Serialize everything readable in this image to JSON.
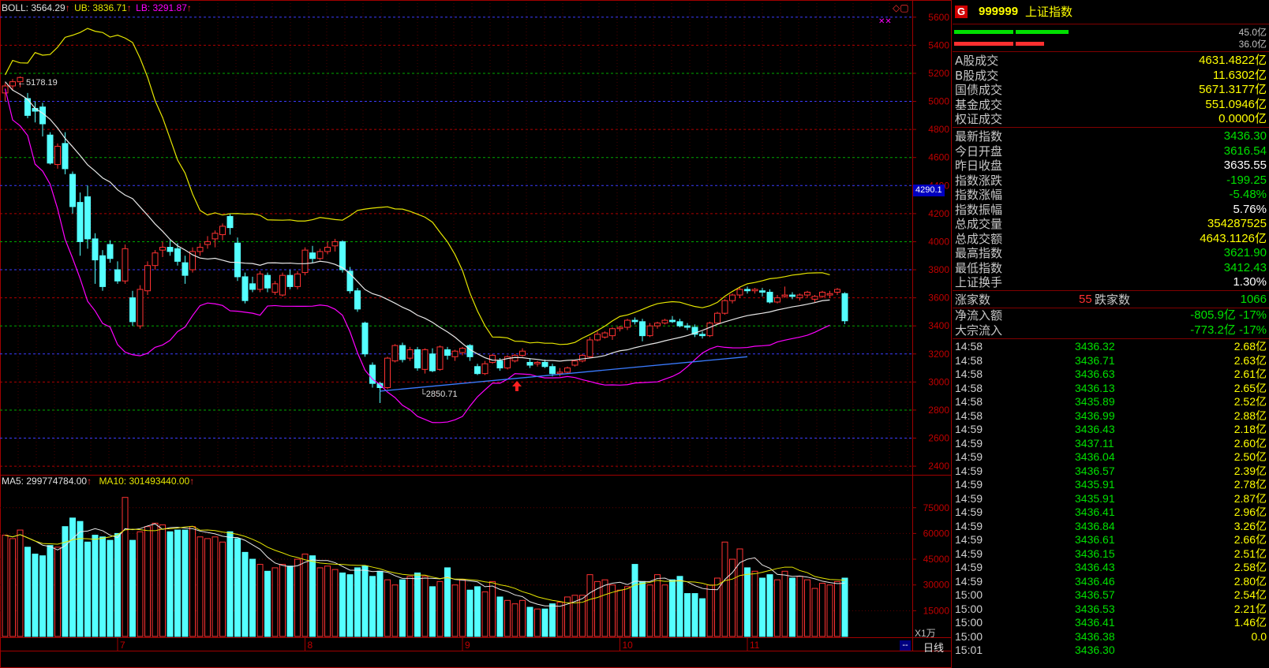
{
  "colors": {
    "up": "#ff3232",
    "down": "#54ffff",
    "mid": "#e8e8e8",
    "upper": "#e6e600",
    "lower": "#ff00ff",
    "grid_red": "#b00000",
    "grid_blue": "#3c3cff",
    "grid_green": "#00aa00",
    "axis_text": "#c00000",
    "panel_green": "#00e000",
    "panel_yellow": "#ffff00",
    "panel_red": "#ff3030"
  },
  "indicators": {
    "boll_label": "BOLL: 3564.29",
    "ub_label": "UB: 3836.71",
    "lb_label": "LB: 3291.87",
    "ma5_label": "MA5: 299774784.00",
    "ma10_label": "MA10: 301493440.00"
  },
  "price_axis": {
    "ticks": [
      "5600",
      "5400",
      "5200",
      "5000",
      "4800",
      "4600",
      "4400",
      "4200",
      "4000",
      "3800",
      "3600",
      "3400",
      "3200",
      "3000",
      "2800",
      "2600",
      "2400"
    ],
    "cursor_value": "4290.1"
  },
  "volume_axis": {
    "ticks": [
      "75000",
      "60000",
      "45000",
      "30000",
      "15000"
    ],
    "unit": "X1万"
  },
  "x_axis": {
    "month_labels": [
      "7",
      "8",
      "9",
      "10",
      "11"
    ],
    "period": "日线"
  },
  "annotations": {
    "high": "5178.19",
    "low": "2850.71"
  },
  "chart_data": {
    "type": "candlestick",
    "ohlc": [
      [
        5060,
        5130,
        5000,
        5110
      ],
      [
        5110,
        5160,
        5080,
        5140
      ],
      [
        5140,
        5178,
        5100,
        5170
      ],
      [
        5020,
        5060,
        4880,
        4900
      ],
      [
        4950,
        5000,
        4850,
        4930
      ],
      [
        4960,
        4990,
        4750,
        4840
      ],
      [
        4760,
        4780,
        4550,
        4560
      ],
      [
        4550,
        4700,
        4520,
        4680
      ],
      [
        4700,
        4780,
        4480,
        4520
      ],
      [
        4480,
        4500,
        4200,
        4250
      ],
      [
        4280,
        4350,
        3900,
        4000
      ],
      [
        4320,
        4400,
        3950,
        4020
      ],
      [
        4020,
        4060,
        3700,
        3870
      ],
      [
        3900,
        3940,
        3650,
        3680
      ],
      [
        3980,
        4010,
        3850,
        3880
      ],
      [
        3800,
        3860,
        3700,
        3720
      ],
      [
        3720,
        3980,
        3700,
        3950
      ],
      [
        3600,
        3650,
        3400,
        3430
      ],
      [
        3400,
        3690,
        3380,
        3660
      ],
      [
        3650,
        3860,
        3620,
        3830
      ],
      [
        3830,
        3940,
        3800,
        3920
      ],
      [
        3940,
        4000,
        3890,
        3960
      ],
      [
        3960,
        4010,
        3900,
        3930
      ],
      [
        3950,
        3990,
        3830,
        3860
      ],
      [
        3850,
        3900,
        3700,
        3760
      ],
      [
        3800,
        3960,
        3780,
        3930
      ],
      [
        3930,
        3990,
        3900,
        3960
      ],
      [
        3980,
        4040,
        3950,
        4000
      ],
      [
        4020,
        4080,
        3960,
        4060
      ],
      [
        4050,
        4130,
        4010,
        4110
      ],
      [
        4180,
        4200,
        4050,
        4100
      ],
      [
        3990,
        4030,
        3720,
        3750
      ],
      [
        3750,
        3780,
        3560,
        3580
      ],
      [
        3700,
        3750,
        3640,
        3660
      ],
      [
        3660,
        3790,
        3640,
        3770
      ],
      [
        3760,
        3780,
        3640,
        3670
      ],
      [
        3640,
        3720,
        3620,
        3700
      ],
      [
        3620,
        3780,
        3610,
        3760
      ],
      [
        3760,
        3800,
        3660,
        3680
      ],
      [
        3680,
        3790,
        3660,
        3770
      ],
      [
        3780,
        3960,
        3760,
        3940
      ],
      [
        3920,
        3970,
        3850,
        3880
      ],
      [
        3880,
        3950,
        3870,
        3930
      ],
      [
        3930,
        4000,
        3910,
        3960
      ],
      [
        3970,
        4020,
        3930,
        4000
      ],
      [
        4000,
        4010,
        3780,
        3800
      ],
      [
        3790,
        3820,
        3630,
        3650
      ],
      [
        3650,
        3670,
        3500,
        3520
      ],
      [
        3420,
        3430,
        3180,
        3200
      ],
      [
        3120,
        3140,
        2960,
        2990
      ],
      [
        2990,
        3000,
        2850,
        2960
      ],
      [
        2960,
        3180,
        2950,
        3170
      ],
      [
        3150,
        3270,
        3140,
        3260
      ],
      [
        3260,
        3280,
        3140,
        3160
      ],
      [
        3170,
        3250,
        3150,
        3230
      ],
      [
        3230,
        3250,
        3080,
        3100
      ],
      [
        3090,
        3240,
        3060,
        3230
      ],
      [
        3200,
        3240,
        3070,
        3080
      ],
      [
        3090,
        3260,
        3080,
        3250
      ],
      [
        3230,
        3250,
        3160,
        3190
      ],
      [
        3180,
        3230,
        3150,
        3220
      ],
      [
        3210,
        3250,
        3190,
        3240
      ],
      [
        3260,
        3270,
        3150,
        3180
      ],
      [
        3110,
        3130,
        3050,
        3060
      ],
      [
        3060,
        3150,
        3050,
        3130
      ],
      [
        3140,
        3200,
        3130,
        3190
      ],
      [
        3150,
        3170,
        3080,
        3100
      ],
      [
        3100,
        3190,
        3090,
        3180
      ],
      [
        3150,
        3200,
        3140,
        3190
      ],
      [
        3190,
        3240,
        3180,
        3220
      ],
      [
        3140,
        3170,
        3100,
        3120
      ],
      [
        3130,
        3150,
        3110,
        3140
      ],
      [
        3140,
        3160,
        3100,
        3110
      ],
      [
        3110,
        3130,
        3040,
        3060
      ],
      [
        3060,
        3100,
        3040,
        3070
      ],
      [
        3070,
        3110,
        3060,
        3100
      ],
      [
        3120,
        3160,
        3110,
        3150
      ],
      [
        3150,
        3200,
        3140,
        3190
      ],
      [
        3180,
        3320,
        3170,
        3300
      ],
      [
        3300,
        3360,
        3290,
        3340
      ],
      [
        3320,
        3360,
        3310,
        3350
      ],
      [
        3330,
        3390,
        3300,
        3380
      ],
      [
        3380,
        3400,
        3360,
        3390
      ],
      [
        3390,
        3450,
        3370,
        3440
      ],
      [
        3440,
        3460,
        3410,
        3430
      ],
      [
        3430,
        3450,
        3290,
        3330
      ],
      [
        3330,
        3420,
        3320,
        3400
      ],
      [
        3400,
        3430,
        3380,
        3420
      ],
      [
        3420,
        3450,
        3410,
        3440
      ],
      [
        3440,
        3470,
        3420,
        3430
      ],
      [
        3430,
        3450,
        3390,
        3400
      ],
      [
        3400,
        3420,
        3370,
        3390
      ],
      [
        3390,
        3410,
        3320,
        3340
      ],
      [
        3340,
        3360,
        3310,
        3330
      ],
      [
        3330,
        3430,
        3320,
        3420
      ],
      [
        3420,
        3500,
        3410,
        3490
      ],
      [
        3490,
        3590,
        3480,
        3580
      ],
      [
        3580,
        3630,
        3560,
        3620
      ],
      [
        3620,
        3680,
        3600,
        3660
      ],
      [
        3660,
        3680,
        3630,
        3650
      ],
      [
        3650,
        3670,
        3630,
        3660
      ],
      [
        3650,
        3670,
        3610,
        3640
      ],
      [
        3640,
        3660,
        3560,
        3570
      ],
      [
        3570,
        3620,
        3560,
        3600
      ],
      [
        3610,
        3680,
        3600,
        3620
      ],
      [
        3620,
        3640,
        3590,
        3610
      ],
      [
        3600,
        3630,
        3580,
        3620
      ],
      [
        3620,
        3650,
        3600,
        3640
      ],
      [
        3590,
        3620,
        3570,
        3610
      ],
      [
        3610,
        3650,
        3600,
        3640
      ],
      [
        3620,
        3650,
        3600,
        3630
      ],
      [
        3640,
        3670,
        3620,
        3660
      ],
      [
        3630,
        3640,
        3412,
        3436
      ]
    ],
    "volume": [
      59000,
      57000,
      62000,
      52000,
      48000,
      47000,
      53000,
      52000,
      64000,
      69000,
      67000,
      55000,
      59000,
      58000,
      56000,
      60000,
      81000,
      56000,
      61000,
      64000,
      66000,
      65000,
      61000,
      62000,
      62000,
      64000,
      58000,
      57000,
      58000,
      55000,
      61000,
      57000,
      49000,
      45000,
      42000,
      38000,
      40000,
      42000,
      41000,
      45000,
      48000,
      47000,
      40000,
      41000,
      39000,
      37000,
      36000,
      40000,
      41000,
      35000,
      38000,
      33000,
      30000,
      33000,
      35000,
      37000,
      35000,
      29000,
      32000,
      40000,
      30000,
      33000,
      27000,
      29000,
      26000,
      32000,
      23000,
      21000,
      19000,
      21000,
      17000,
      16000,
      16000,
      19000,
      20000,
      23000,
      24000,
      24000,
      36000,
      32000,
      33000,
      30000,
      27000,
      29000,
      42000,
      32000,
      30000,
      36000,
      30000,
      33000,
      35000,
      25000,
      25000,
      22000,
      30000,
      34000,
      55000,
      45000,
      51000,
      40000,
      38000,
      34000,
      36000,
      33000,
      38000,
      34000,
      35000,
      33000,
      28000,
      31000,
      30000,
      32000,
      34000
    ],
    "series": [
      {
        "name": "BOLL",
        "values": []
      },
      {
        "name": "UB",
        "values": []
      },
      {
        "name": "LB",
        "values": []
      }
    ],
    "y_range": [
      2350,
      5700
    ],
    "volume_range": [
      0,
      85000
    ]
  },
  "panel": {
    "code": "999999",
    "name": "上证指数",
    "logo": "G",
    "bar_top_value": "45.0亿",
    "bar_bottom_value": "36.0亿",
    "rows_yellow": [
      {
        "label": "A股成交",
        "value": "4631.4822亿"
      },
      {
        "label": "B股成交",
        "value": "11.6302亿"
      },
      {
        "label": "国债成交",
        "value": "5671.3177亿"
      },
      {
        "label": "基金成交",
        "value": "551.0946亿"
      },
      {
        "label": "权证成交",
        "value": "0.0000亿"
      }
    ],
    "rows_stats": [
      {
        "label": "最新指数",
        "value": "3436.30",
        "color": "#00e000"
      },
      {
        "label": "今日开盘",
        "value": "3616.54",
        "color": "#00e000"
      },
      {
        "label": "昨日收盘",
        "value": "3635.55",
        "color": "#ffffff"
      },
      {
        "label": "指数涨跌",
        "value": "-199.25",
        "color": "#00e000"
      },
      {
        "label": "指数涨幅",
        "value": "-5.48%",
        "color": "#00e000"
      },
      {
        "label": "指数振幅",
        "value": "5.76%",
        "color": "#ffffff"
      },
      {
        "label": "总成交量",
        "value": "354287525",
        "color": "#ffff00"
      },
      {
        "label": "总成交额",
        "value": "4643.1126亿",
        "color": "#ffff00"
      },
      {
        "label": "最高指数",
        "value": "3621.90",
        "color": "#00e000"
      },
      {
        "label": "最低指数",
        "value": "3412.43",
        "color": "#00e000"
      },
      {
        "label": "上证换手",
        "value": "1.30%",
        "color": "#ffffff"
      }
    ],
    "advance_label": "涨家数",
    "advance_value": "55",
    "decline_label": "跌家数",
    "decline_value": "1066",
    "flow_rows": [
      {
        "label": "净流入额",
        "value": "-805.9亿 -17%"
      },
      {
        "label": "大宗流入",
        "value": "-773.2亿 -17%"
      }
    ],
    "ticks": [
      {
        "t": "14:58",
        "p": "3436.32",
        "v": "2.68亿"
      },
      {
        "t": "14:58",
        "p": "3436.71",
        "v": "2.63亿"
      },
      {
        "t": "14:58",
        "p": "3436.63",
        "v": "2.61亿"
      },
      {
        "t": "14:58",
        "p": "3436.13",
        "v": "2.65亿"
      },
      {
        "t": "14:58",
        "p": "3435.89",
        "v": "2.52亿"
      },
      {
        "t": "14:58",
        "p": "3436.99",
        "v": "2.88亿"
      },
      {
        "t": "14:59",
        "p": "3436.43",
        "v": "2.18亿"
      },
      {
        "t": "14:59",
        "p": "3437.11",
        "v": "2.60亿"
      },
      {
        "t": "14:59",
        "p": "3436.04",
        "v": "2.50亿"
      },
      {
        "t": "14:59",
        "p": "3436.57",
        "v": "2.39亿"
      },
      {
        "t": "14:59",
        "p": "3435.91",
        "v": "2.78亿"
      },
      {
        "t": "14:59",
        "p": "3435.91",
        "v": "2.87亿"
      },
      {
        "t": "14:59",
        "p": "3436.41",
        "v": "2.96亿"
      },
      {
        "t": "14:59",
        "p": "3436.84",
        "v": "3.26亿"
      },
      {
        "t": "14:59",
        "p": "3436.61",
        "v": "2.66亿"
      },
      {
        "t": "14:59",
        "p": "3436.15",
        "v": "2.51亿"
      },
      {
        "t": "14:59",
        "p": "3436.43",
        "v": "2.58亿"
      },
      {
        "t": "14:59",
        "p": "3436.46",
        "v": "2.80亿"
      },
      {
        "t": "15:00",
        "p": "3436.57",
        "v": "2.54亿"
      },
      {
        "t": "15:00",
        "p": "3436.53",
        "v": "2.21亿"
      },
      {
        "t": "15:00",
        "p": "3436.41",
        "v": "1.46亿"
      },
      {
        "t": "15:00",
        "p": "3436.38",
        "v": "0.0"
      },
      {
        "t": "15:01",
        "p": "3436.30",
        "v": ""
      }
    ]
  }
}
